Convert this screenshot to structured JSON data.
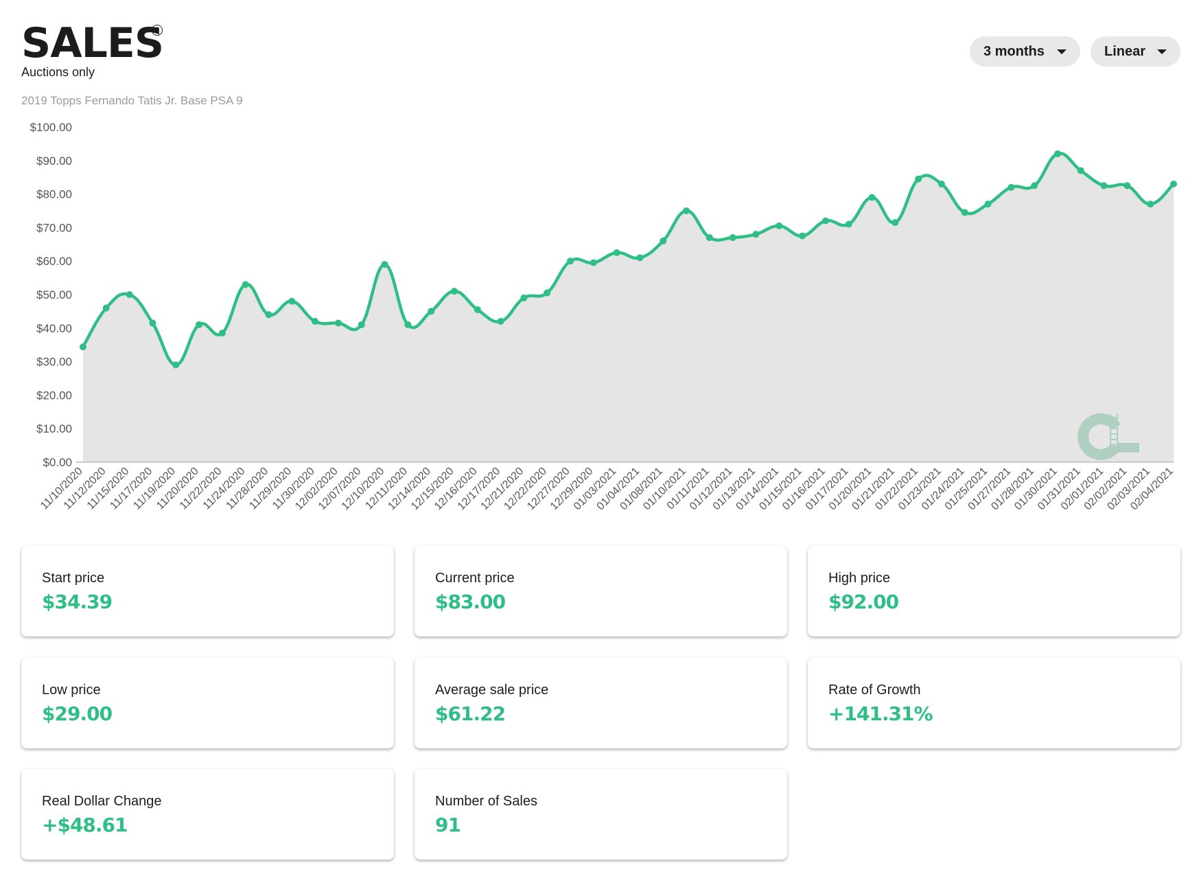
{
  "header": {
    "title": "SALES",
    "help_icon": "question-circle-icon",
    "subtitle": "Auctions only",
    "item_name": "2019 Topps Fernando Tatis Jr. Base PSA 9"
  },
  "controls": {
    "range": "3 months",
    "scale": "Linear"
  },
  "colors": {
    "accent": "#2fbf86",
    "area_fill": "#e5e5e5",
    "logo": "#afcfc0"
  },
  "logo": {
    "text": "CL"
  },
  "chart_data": {
    "type": "area",
    "xlabel": "",
    "ylabel": "",
    "ylim": [
      0,
      100
    ],
    "yticks": [
      "$0.00",
      "$10.00",
      "$20.00",
      "$30.00",
      "$40.00",
      "$50.00",
      "$60.00",
      "$70.00",
      "$80.00",
      "$90.00",
      "$100.00"
    ],
    "ytick_values": [
      0,
      10,
      20,
      30,
      40,
      50,
      60,
      70,
      80,
      90,
      100
    ],
    "grid": false,
    "categories": [
      "11/10/2020",
      "11/12/2020",
      "11/15/2020",
      "11/17/2020",
      "11/19/2020",
      "11/20/2020",
      "11/22/2020",
      "11/24/2020",
      "11/28/2020",
      "11/29/2020",
      "11/30/2020",
      "12/02/2020",
      "12/07/2020",
      "12/10/2020",
      "12/11/2020",
      "12/14/2020",
      "12/15/2020",
      "12/16/2020",
      "12/17/2020",
      "12/21/2020",
      "12/22/2020",
      "12/27/2020",
      "12/29/2020",
      "01/03/2021",
      "01/04/2021",
      "01/08/2021",
      "01/10/2021",
      "01/11/2021",
      "01/12/2021",
      "01/13/2021",
      "01/14/2021",
      "01/15/2021",
      "01/16/2021",
      "01/17/2021",
      "01/20/2021",
      "01/21/2021",
      "01/22/2021",
      "01/23/2021",
      "01/24/2021",
      "01/25/2021",
      "01/27/2021",
      "01/28/2021",
      "01/30/2021",
      "01/31/2021",
      "02/01/2021",
      "02/02/2021",
      "02/03/2021",
      "02/04/2021"
    ],
    "values": [
      34.39,
      46,
      50,
      41.5,
      29,
      41,
      38.5,
      53,
      44,
      48,
      42,
      41.5,
      41,
      59,
      41,
      45,
      51,
      45.5,
      42,
      49,
      50.5,
      60,
      59.5,
      62.5,
      61,
      66,
      75,
      67,
      67,
      68,
      70.5,
      67.5,
      72,
      71,
      79,
      71.5,
      84.5,
      83,
      74.5,
      77,
      82,
      82.5,
      92,
      87,
      82.5,
      82.5,
      77,
      83
    ]
  },
  "stats": [
    {
      "label": "Start price",
      "value": "$34.39"
    },
    {
      "label": "Current price",
      "value": "$83.00"
    },
    {
      "label": "High price",
      "value": "$92.00"
    },
    {
      "label": "Low price",
      "value": "$29.00"
    },
    {
      "label": "Average sale price",
      "value": "$61.22"
    },
    {
      "label": "Rate of Growth",
      "value": "+141.31%"
    },
    {
      "label": "Real Dollar Change",
      "value": "+$48.61"
    },
    {
      "label": "Number of Sales",
      "value": "91"
    }
  ]
}
